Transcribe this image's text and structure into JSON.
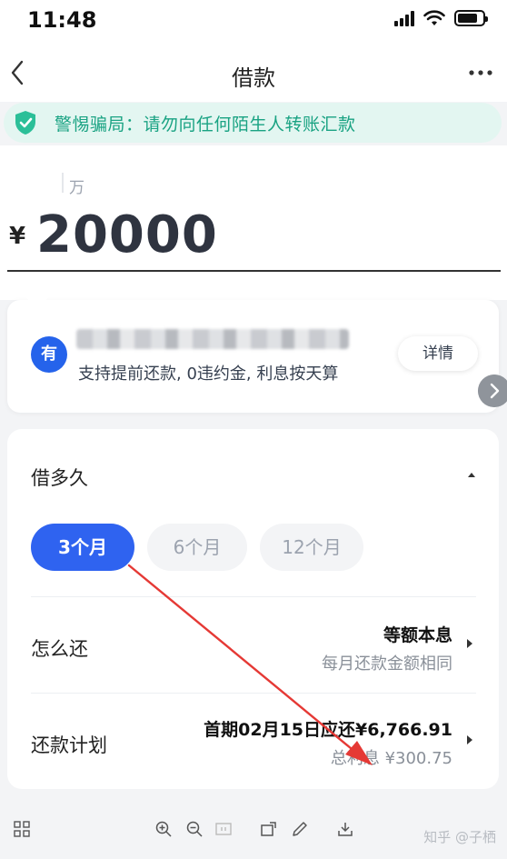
{
  "status_bar": {
    "time": "11:48"
  },
  "nav": {
    "title": "借款"
  },
  "warning": {
    "text": "警惕骗局：请勿向任何陌生人转账汇款"
  },
  "amount": {
    "unit_hint": "万",
    "currency": "¥",
    "value": "20000"
  },
  "lender": {
    "logo_char": "有",
    "description": "支持提前还款, 0违约金, 利息按天算",
    "detail_button": "详情"
  },
  "term": {
    "heading": "借多久",
    "options": [
      {
        "label": "3个月",
        "selected": true
      },
      {
        "label": "6个月",
        "selected": false
      },
      {
        "label": "12个月",
        "selected": false
      }
    ]
  },
  "repay_method": {
    "label": "怎么还",
    "value": "等额本息",
    "note": "每月还款金额相同"
  },
  "repay_plan": {
    "label": "还款计划",
    "first_payment": "首期02月15日应还¥6,766.91",
    "total_interest": "总利息 ¥300.75"
  },
  "watermark": "知乎 @子栖",
  "colors": {
    "accent": "#2f63f0",
    "warning_text": "#1aa383",
    "warning_bg": "#e3f6f1",
    "annotation_arrow": "#e53935"
  },
  "icons": [
    "shield-check-icon",
    "back-chevron-icon",
    "more-dots-icon",
    "grid-icon",
    "zoom-in-icon",
    "zoom-out-icon",
    "fit-page-icon",
    "rotate-icon",
    "pen-icon",
    "download-icon"
  ]
}
